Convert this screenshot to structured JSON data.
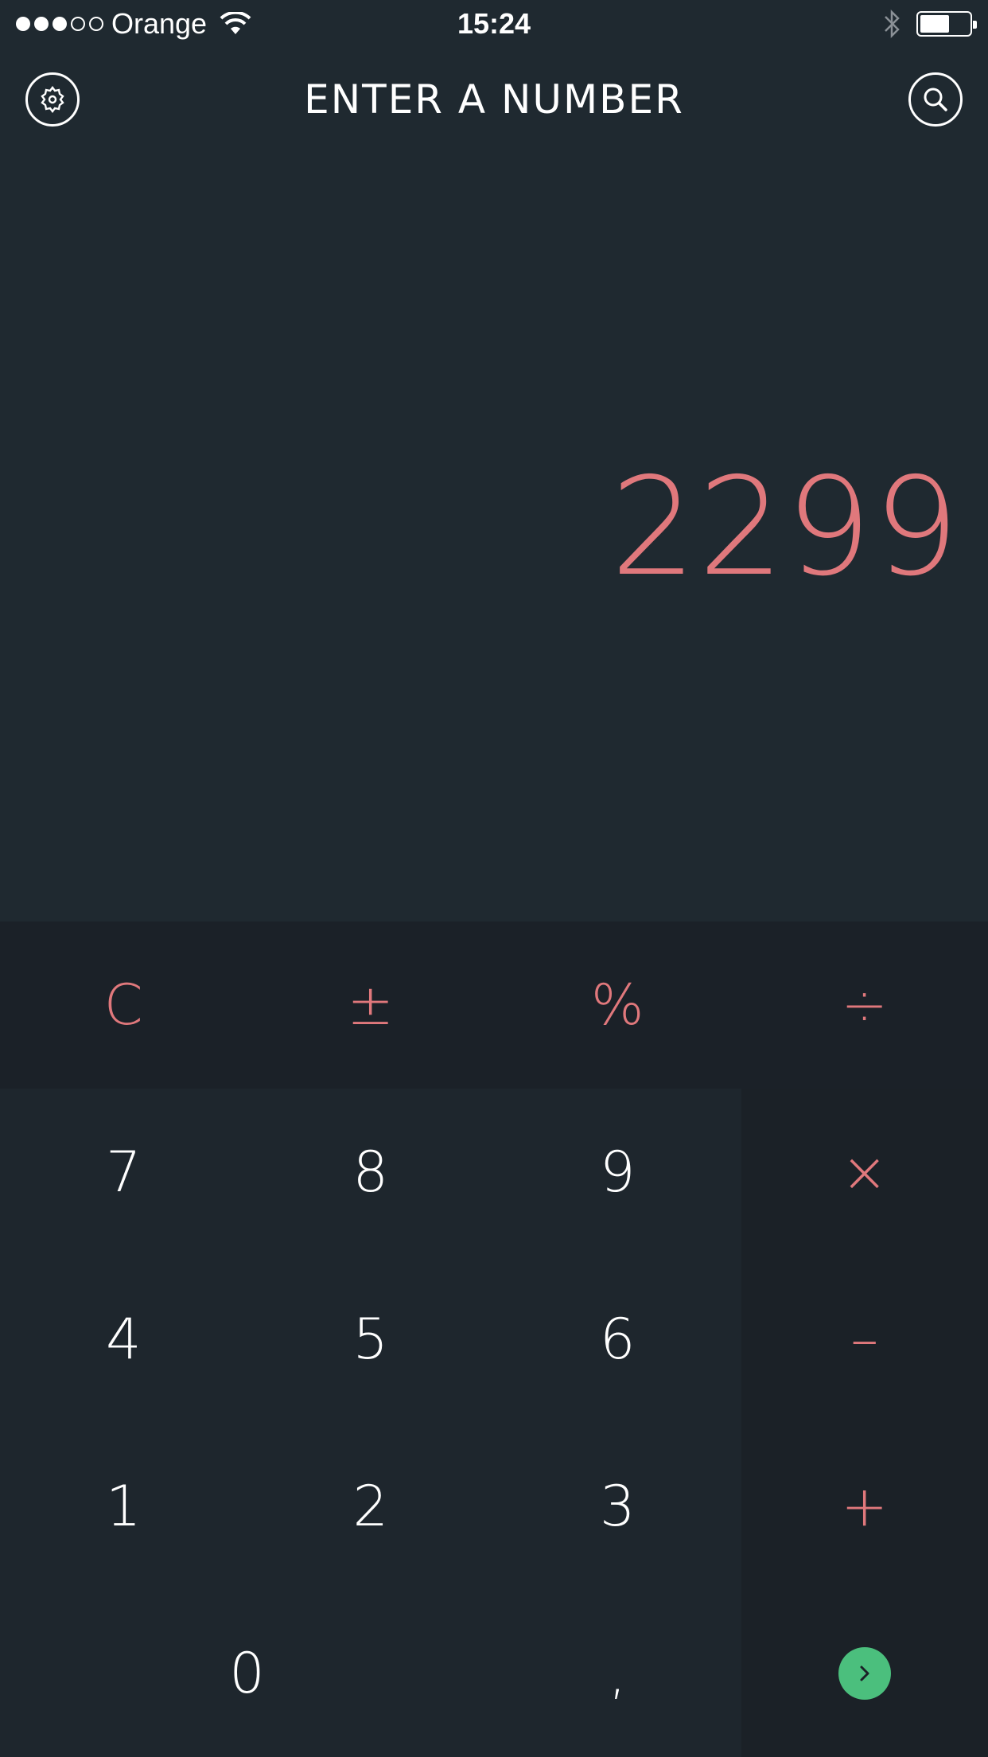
{
  "status_bar": {
    "carrier": "Orange",
    "time": "15:24",
    "signal_bars_filled": 3,
    "signal_bars_total": 5,
    "battery_level": 0.6
  },
  "header": {
    "title": "ENTER A NUMBER",
    "left_icon": "gear-icon",
    "right_icon": "search-icon"
  },
  "display": {
    "value": "2299"
  },
  "keypad": {
    "function_row": [
      "C",
      "±",
      "%",
      "÷"
    ],
    "rows": [
      {
        "digits": [
          "7",
          "8",
          "9"
        ],
        "op": "×"
      },
      {
        "digits": [
          "4",
          "5",
          "6"
        ],
        "op": "–"
      },
      {
        "digits": [
          "1",
          "2",
          "3"
        ],
        "op": "+"
      }
    ],
    "zero": "0",
    "decimal": ",",
    "submit_icon": "chevron-right-icon"
  },
  "colors": {
    "background": "#1f2930",
    "accent": "#e0787c",
    "submit": "#4bbf7d"
  }
}
